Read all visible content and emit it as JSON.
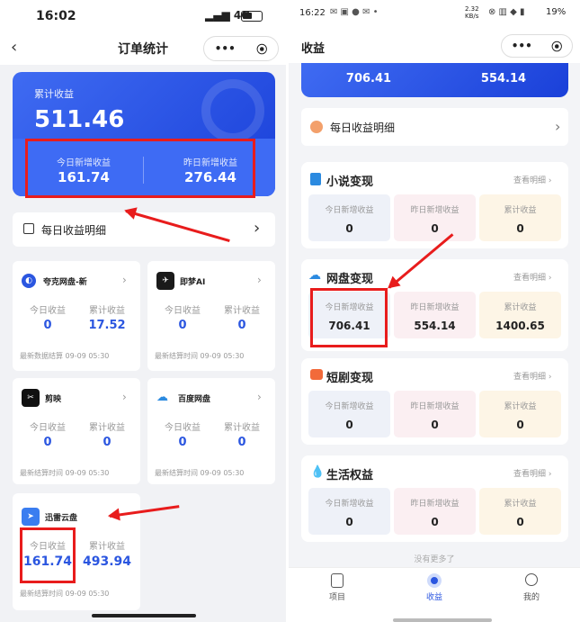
{
  "colors": {
    "accent": "#2b56e0",
    "highlight": "#e81c1c"
  },
  "left": {
    "status": {
      "time": "16:02",
      "network": "4G"
    },
    "nav": {
      "title": "订单统计",
      "more": "•••",
      "target": "⦿"
    },
    "summary": {
      "label": "累计收益",
      "total": "511.46",
      "today_label": "今日新增收益",
      "today_value": "161.74",
      "yesterday_label": "昨日新增收益",
      "yesterday_value": "276.44"
    },
    "daily_detail": {
      "label": "每日收益明细",
      "chevron": "›"
    },
    "platforms": [
      {
        "name": "夸克网盘-新",
        "icon": "quark-icon",
        "today_label": "今日收益",
        "today": "0",
        "total_label": "累计收益",
        "total": "17.52",
        "footer": "最新数据结算  09-09 05:30"
      },
      {
        "name": "即梦AI",
        "icon": "jimeng-icon",
        "today_label": "今日收益",
        "today": "0",
        "total_label": "累计收益",
        "total": "0",
        "footer": "最新结算时间  09-09 05:30"
      },
      {
        "name": "剪映",
        "icon": "capcut-icon",
        "today_label": "今日收益",
        "today": "0",
        "total_label": "累计收益",
        "total": "0",
        "footer": "最新结算时间  09-09 05:30"
      },
      {
        "name": "百度网盘",
        "icon": "baidu-pan-icon",
        "today_label": "今日收益",
        "today": "0",
        "total_label": "累计收益",
        "total": "0",
        "footer": "最新结算时间  09-09 05:30"
      },
      {
        "name": "迅雷云盘",
        "icon": "xunlei-icon",
        "today_label": "今日收益",
        "today": "161.74",
        "total_label": "累计收益",
        "total": "493.94",
        "footer": "最新结算时间  09-09 05:30"
      }
    ]
  },
  "right": {
    "status": {
      "time": "16:22",
      "speed": "2.32 KB/s",
      "battery": "19%"
    },
    "nav": {
      "title": "收益",
      "more": "•••",
      "target": "⦿"
    },
    "top_values": {
      "a": "706.41",
      "b": "554.14"
    },
    "daily_detail": {
      "label": "每日收益明细",
      "chevron": "›"
    },
    "sections": [
      {
        "title": "小说变现",
        "icon": "book-icon",
        "link": "查看明细 ›",
        "boxes": [
          {
            "label": "今日新增收益",
            "value": "0"
          },
          {
            "label": "昨日新增收益",
            "value": "0"
          },
          {
            "label": "累计收益",
            "value": "0"
          }
        ]
      },
      {
        "title": "网盘变现",
        "icon": "cloud-icon",
        "link": "查看明细 ›",
        "boxes": [
          {
            "label": "今日新增收益",
            "value": "706.41"
          },
          {
            "label": "昨日新增收益",
            "value": "554.14"
          },
          {
            "label": "累计收益",
            "value": "1400.65"
          }
        ]
      },
      {
        "title": "短剧变现",
        "icon": "play-icon",
        "link": "查看明细 ›",
        "boxes": [
          {
            "label": "今日新增收益",
            "value": "0"
          },
          {
            "label": "昨日新增收益",
            "value": "0"
          },
          {
            "label": "累计收益",
            "value": "0"
          }
        ]
      },
      {
        "title": "生活权益",
        "icon": "drop-icon",
        "link": "查看明细 ›",
        "boxes": [
          {
            "label": "今日新增收益",
            "value": "0"
          },
          {
            "label": "昨日新增收益",
            "value": "0"
          },
          {
            "label": "累计收益",
            "value": "0"
          }
        ]
      }
    ],
    "no_more": "没有更多了",
    "tabs": [
      {
        "label": "项目",
        "icon": "project-icon"
      },
      {
        "label": "收益",
        "icon": "earnings-icon"
      },
      {
        "label": "我的",
        "icon": "profile-icon"
      }
    ]
  }
}
